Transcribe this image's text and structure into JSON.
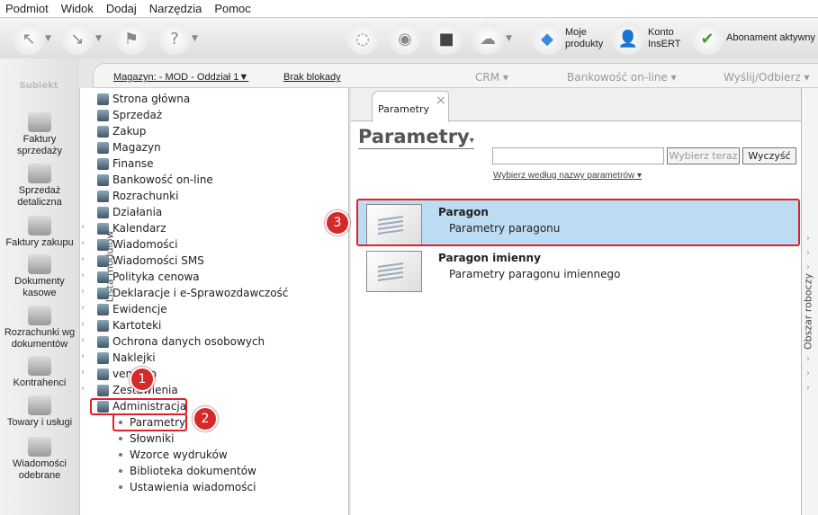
{
  "menu": [
    "Podmiot",
    "Widok",
    "Dodaj",
    "Narzędzia",
    "Pomoc"
  ],
  "toolbar": {
    "moje_produkty": "Moje produkty",
    "konto": "Konto InsERT",
    "abonament": "Abonament aktywny"
  },
  "logo": "Subiekt",
  "left_nav": [
    "Faktury sprzedaży",
    "Sprzedaż detaliczna",
    "Faktury zakupu",
    "Dokumenty kasowe",
    "Rozrachunki wg dokumentów",
    "Kontrahenci",
    "Towary i usługi",
    "Wiadomości odebrane"
  ],
  "strip": {
    "magazyn": "Magazyn: - MOD - Oddział 1▼",
    "blokady": "Brak blokady",
    "crm": "CRM ▾",
    "bank": "Bankowość on-line ▾",
    "wyslij": "Wyślij/Odbierz ▾"
  },
  "module_panel_label": "Lista modułów",
  "modules": [
    "Strona główna",
    "Sprzedaż",
    "Zakup",
    "Magazyn",
    "Finanse",
    "Bankowość on-line",
    "Rozrachunki",
    "Działania",
    "Kalendarz",
    "Wiadomości",
    "Wiadomości SMS",
    "Polityka cenowa",
    "Deklaracje i e-Sprawozdawczość",
    "Ewidencje",
    "Kartoteki",
    "Ochrona danych osobowych",
    "Naklejki",
    "vendero",
    "Zestawienia",
    "Administracja"
  ],
  "submodules": [
    "Parametry",
    "Słowniki",
    "Wzorce wydruków",
    "Biblioteka dokumentów",
    "Ustawienia wiadomości"
  ],
  "tab": {
    "label": "Parametry",
    "close": "×"
  },
  "main": {
    "title": "Parametry",
    "search_value": "",
    "choose_btn": "Wybierz teraz",
    "clear_btn": "Wyczyść",
    "filter": "Wybierz według nazwy parametrów ▾"
  },
  "rows": [
    {
      "title": "Paragon",
      "desc": "Parametry paragonu",
      "selected": true
    },
    {
      "title": "Paragon imienny",
      "desc": "Parametry paragonu imiennego",
      "selected": false
    }
  ],
  "work_area_label": "Obszar roboczy",
  "annotations": [
    "1",
    "2",
    "3"
  ],
  "colors": {
    "selected_row": "#bcdcf3",
    "annotation": "#d42a2a"
  }
}
